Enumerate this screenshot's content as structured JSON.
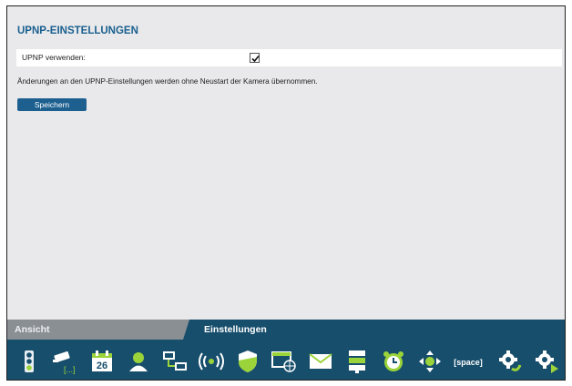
{
  "settings": {
    "title": "UPNP-EINSTELLUNGEN",
    "upnp_label": "UPNP verwenden:",
    "upnp_checked": true,
    "info_text": "Änderungen an den UPNP-Einstellungen werden ohne Neustart der Kamera übernommen.",
    "save_label": "Speichern"
  },
  "tabs": {
    "view": "Ansicht",
    "settings": "Einstellungen"
  },
  "toolbar": {
    "calendar_day": "26",
    "space_label": "[space]",
    "icons": [
      "traffic-light-icon",
      "camera-icon",
      "calendar-icon",
      "user-icon",
      "network-icon",
      "wireless-icon",
      "shield-icon",
      "web-icon",
      "mail-icon",
      "storage-icon",
      "alarm-clock-icon",
      "ptz-icon",
      "space-icon",
      "gear-refresh-icon",
      "gear-play-icon"
    ]
  },
  "colors": {
    "accent": "#1a5f8f",
    "icon_green": "#9bd43a",
    "toolbar_bg": "#174e6c"
  }
}
